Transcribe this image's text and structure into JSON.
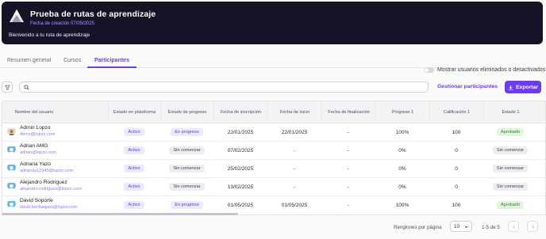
{
  "header": {
    "title": "Prueba de rutas de aprendizaje",
    "created": "Fecha de creación 07/05/2025",
    "welcome": "Bienvenido a tu ruta de aprendizaje",
    "logo_icon": "mountain-logo-icon"
  },
  "tabs": [
    {
      "label": "Resumen general",
      "active": false
    },
    {
      "label": "Cursos",
      "active": false
    },
    {
      "label": "Participantes",
      "active": true
    }
  ],
  "toggle": {
    "label": "Mostrar usuarios eliminados o desactivados",
    "on": false
  },
  "toolbar": {
    "filter_icon": "filter-icon",
    "search_placeholder": "",
    "search_value": "",
    "manage_label": "Gestionar participantes",
    "export_label": "Exportar"
  },
  "table": {
    "headers": [
      "Nombre del usuario",
      "Estado en plataforma",
      "Estado de progreso",
      "Fecha de inscripción",
      "Fecha de inicio",
      "Fecha de finalización",
      "Progreso 1",
      "Calificación 1",
      "Estado 1"
    ],
    "rows": [
      {
        "name": "Admin Lopzo",
        "email": "demo@lopzo.com",
        "platform": "Activo",
        "progress_state": "En progreso",
        "enrolled": "22/01/2025",
        "start": "22/01/2025",
        "end": "-",
        "progress": "100%",
        "grade": "100",
        "status": "Aprobado"
      },
      {
        "name": "Adrian AMG",
        "email": "adrian@lopzo.com",
        "platform": "Activo",
        "progress_state": "Sin comenzar",
        "enrolled": "07/02/2025",
        "start": "-",
        "end": "-",
        "progress": "0%",
        "grade": "0",
        "status": "Sin comenzar"
      },
      {
        "name": "Adriana Yazo",
        "email": "adrianay12345@lopzo.com",
        "platform": "Activo",
        "progress_state": "Sin comenzar",
        "enrolled": "25/02/2025",
        "start": "-",
        "end": "-",
        "progress": "0%",
        "grade": "0",
        "status": "Sin comenzar"
      },
      {
        "name": "Alejandro Rodriguez",
        "email": "alejandro.rodriguez@lopzo.com",
        "platform": "Activo",
        "progress_state": "Sin comenzar",
        "enrolled": "13/02/2025",
        "start": "-",
        "end": "-",
        "progress": "0%",
        "grade": "0",
        "status": "Sin comenzar"
      },
      {
        "name": "David Soporte",
        "email": "david.benhaques@lopzo.com",
        "platform": "Activo",
        "progress_state": "En progreso",
        "enrolled": "01/05/2025",
        "start": "01/05/2025",
        "end": "-",
        "progress": "100%",
        "grade": "100",
        "status": "Aprobado"
      }
    ]
  },
  "pagination": {
    "rows_label": "Renglones por página",
    "rows_per_page": "10",
    "range": "1-5 de 5"
  },
  "colors": {
    "accent": "#6d3cf0",
    "banner": "#141426",
    "approved": "#2f8a2a"
  }
}
